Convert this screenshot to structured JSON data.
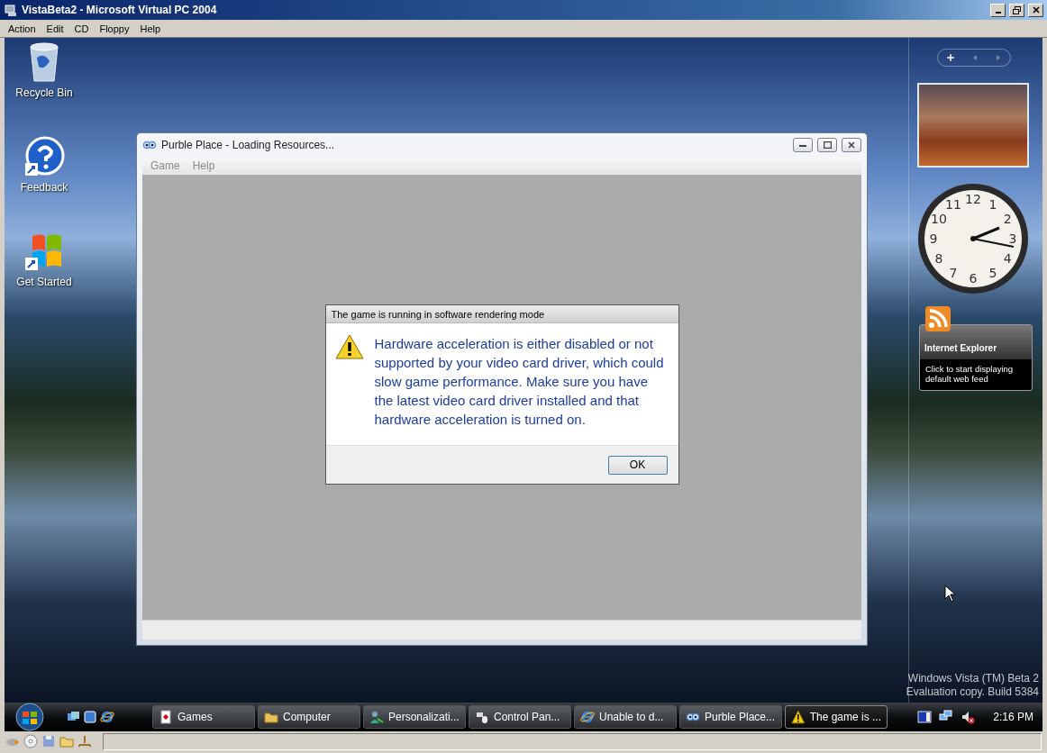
{
  "window": {
    "title": "VistaBeta2 - Microsoft Virtual PC 2004"
  },
  "menu": [
    "Action",
    "Edit",
    "CD",
    "Floppy",
    "Help"
  ],
  "desktop_icons": [
    {
      "kind": "recycle",
      "label": "Recycle Bin"
    },
    {
      "kind": "help",
      "label": "Feedback"
    },
    {
      "kind": "windows",
      "label": "Get Started"
    }
  ],
  "game_window": {
    "title": "Purble Place - Loading Resources...",
    "menu": [
      {
        "label": "Game",
        "disabled": true
      },
      {
        "label": "Help",
        "disabled": true
      }
    ]
  },
  "dialog": {
    "title": "The game is running in software rendering mode",
    "message": "Hardware acceleration is either disabled or not supported by your video card driver, which could slow game performance. Make sure you have the latest video card driver installed and that hardware acceleration is turned on.",
    "button": "OK"
  },
  "sidebar": {
    "clock": {
      "numerals": [
        "12",
        "11",
        "1",
        "10",
        "2",
        "9",
        "3",
        "8",
        "4",
        "7",
        "5",
        "6"
      ]
    },
    "feed": {
      "title": "Internet Explorer",
      "text": "Click to start displaying default web feed"
    }
  },
  "watermark": [
    "Windows Vista (TM) Beta 2",
    "Evaluation copy. Build 5384"
  ],
  "taskbar": {
    "buttons": [
      {
        "kind": "cards",
        "label": "Games",
        "selected": false
      },
      {
        "kind": "folder",
        "label": "Computer",
        "selected": false
      },
      {
        "kind": "person",
        "label": "Personalizati...",
        "selected": false
      },
      {
        "kind": "control",
        "label": "Control Pan...",
        "selected": false
      },
      {
        "kind": "ie",
        "label": "Unable to d...",
        "selected": false
      },
      {
        "kind": "eyes",
        "label": "Purble Place...",
        "selected": false
      },
      {
        "kind": "warning",
        "label": "The game is ...",
        "selected": true
      }
    ],
    "time": "2:16 PM"
  }
}
